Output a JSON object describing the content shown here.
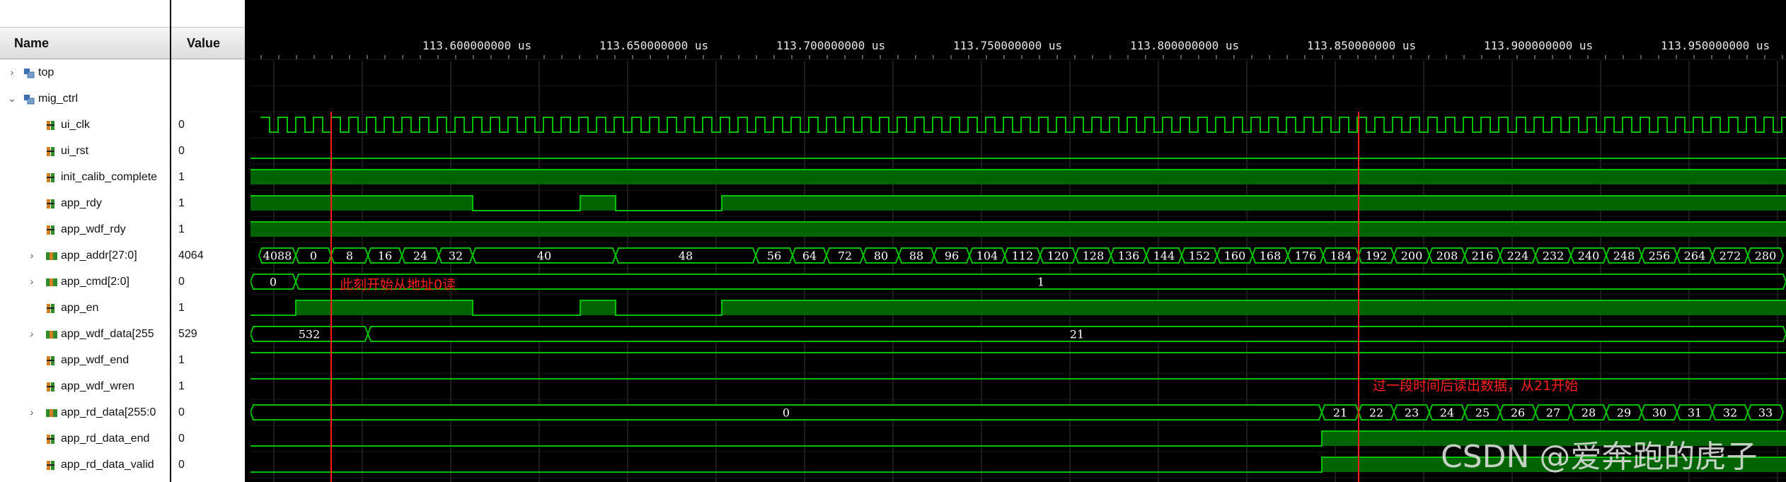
{
  "columns": {
    "name": "Name",
    "value": "Value"
  },
  "signals": [
    {
      "name": "top",
      "value": "",
      "kind": "module",
      "expand": "›"
    },
    {
      "name": "mig_ctrl",
      "value": "",
      "kind": "module",
      "expand": "⌄"
    },
    {
      "name": "ui_clk",
      "value": "0",
      "kind": "bit"
    },
    {
      "name": "ui_rst",
      "value": "0",
      "kind": "bit"
    },
    {
      "name": "init_calib_complete",
      "value": "1",
      "kind": "bit"
    },
    {
      "name": "app_rdy",
      "value": "1",
      "kind": "bit"
    },
    {
      "name": "app_wdf_rdy",
      "value": "1",
      "kind": "bit"
    },
    {
      "name": "app_addr[27:0]",
      "value": "4064",
      "kind": "bus",
      "expand": "›"
    },
    {
      "name": "app_cmd[2:0]",
      "value": "0",
      "kind": "bus",
      "expand": "›"
    },
    {
      "name": "app_en",
      "value": "1",
      "kind": "bit"
    },
    {
      "name": "app_wdf_data[255",
      "value": "529",
      "kind": "bus",
      "expand": "›"
    },
    {
      "name": "app_wdf_end",
      "value": "1",
      "kind": "bit"
    },
    {
      "name": "app_wdf_wren",
      "value": "1",
      "kind": "bit"
    },
    {
      "name": "app_rd_data[255:0",
      "value": "0",
      "kind": "bus",
      "expand": "›"
    },
    {
      "name": "app_rd_data_end",
      "value": "0",
      "kind": "bit"
    },
    {
      "name": "app_rd_data_valid",
      "value": "0",
      "kind": "bit"
    }
  ],
  "timeline": {
    "labels": [
      "113.600000000 us",
      "113.650000000 us",
      "113.700000000 us",
      "113.750000000 us",
      "113.800000000 us",
      "113.850000000 us",
      "113.900000000 us",
      "113.950000000 us"
    ]
  },
  "waves": {
    "app_addr": [
      "4088",
      "0",
      "8",
      "16",
      "24",
      "32",
      "40",
      "48",
      "56",
      "64",
      "72",
      "80",
      "88",
      "96",
      "104",
      "112",
      "120",
      "128",
      "136",
      "144",
      "152",
      "160",
      "168",
      "176",
      "184",
      "192",
      "200",
      "208",
      "216",
      "224",
      "232",
      "240",
      "248",
      "256",
      "264",
      "272",
      "280"
    ],
    "app_cmd": [
      "0",
      "1"
    ],
    "app_wdf_data": [
      "532",
      "21"
    ],
    "app_rd_data": [
      "0",
      "21",
      "22",
      "23",
      "24",
      "25",
      "26",
      "27",
      "28",
      "29",
      "30",
      "31",
      "32",
      "33"
    ]
  },
  "annotations": {
    "read_start": "此刻开始从地址0读",
    "read_data": "过一段时间后读出数据，从21开始"
  },
  "watermark": "CSDN @爱奔跑的虎子",
  "colors": {
    "wave": "#00c000",
    "bus_fill": "#000000",
    "bus_text": "#ffffff",
    "cursor": "#ff1a1a",
    "note": "#ff2020",
    "grid": "#3a3a3a"
  }
}
